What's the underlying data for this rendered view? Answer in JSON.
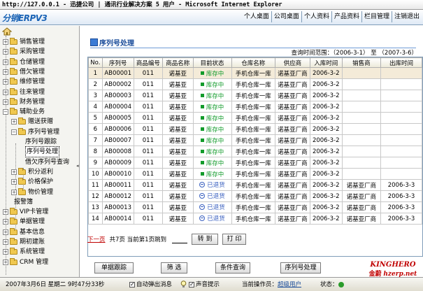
{
  "window": {
    "title": "http://127.0.0.1 - 迅捷公司  | 通讯行业解决方案 5 用户 - Microsoft Internet Explorer"
  },
  "header": {
    "logo_text": "分销ERPV3",
    "nav": [
      "个人桌面",
      "公司桌面",
      "个人资料",
      "产品资料",
      "栏目管理",
      "注销退出"
    ]
  },
  "sidebar": {
    "items": [
      {
        "label": "销售管理",
        "level": 0,
        "expanded": false
      },
      {
        "label": "采购管理",
        "level": 0,
        "expanded": false
      },
      {
        "label": "仓储管理",
        "level": 0,
        "expanded": false
      },
      {
        "label": "借欠管理",
        "level": 0,
        "expanded": false
      },
      {
        "label": "维修管理",
        "level": 0,
        "expanded": false
      },
      {
        "label": "往来管理",
        "level": 0,
        "expanded": false
      },
      {
        "label": "财务管理",
        "level": 0,
        "expanded": false
      },
      {
        "label": "辅助业务",
        "level": 0,
        "expanded": true
      },
      {
        "label": "赠送获赠",
        "level": 1,
        "expanded": false
      },
      {
        "label": "序列号管理",
        "level": 1,
        "expanded": true
      },
      {
        "label": "序列号跟踪",
        "level": 2
      },
      {
        "label": "序列号处理",
        "level": 2,
        "selected": true
      },
      {
        "label": "借欠序列号查询",
        "level": 2
      },
      {
        "label": "积分返利",
        "level": 1,
        "expanded": false
      },
      {
        "label": "价格保护",
        "level": 1,
        "expanded": false
      },
      {
        "label": "物价管理",
        "level": 1,
        "expanded": false
      },
      {
        "label": "报警簿",
        "level": 1
      },
      {
        "label": "VIP卡管理",
        "level": 0,
        "expanded": false
      },
      {
        "label": "单据管理",
        "level": 0,
        "expanded": false
      },
      {
        "label": "基本信息",
        "level": 0,
        "expanded": false
      },
      {
        "label": "期初建账",
        "level": 0,
        "expanded": false
      },
      {
        "label": "系统管理",
        "level": 0,
        "expanded": false
      },
      {
        "label": "CRM 管理",
        "level": 0,
        "expanded": false
      }
    ]
  },
  "main": {
    "heading": "序列号处理",
    "query_range": "查询时间范围：（2006-3-1） 至 （2007-3-6）",
    "table": {
      "columns": [
        "No.",
        "序列号",
        "商品编号",
        "商品名称",
        "目前状态",
        "仓库名称",
        "供应商",
        "入库时间",
        "销售商",
        "出库时间"
      ],
      "rows": [
        [
          "1",
          "AB00001",
          "011",
          "诺基亚",
          "库存中",
          "手机仓库一库",
          "诺基亚厂商",
          "2006-3-2",
          "",
          ""
        ],
        [
          "2",
          "AB00002",
          "011",
          "诺基亚",
          "库存中",
          "手机仓库一库",
          "诺基亚厂商",
          "2006-3-2",
          "",
          ""
        ],
        [
          "3",
          "AB00003",
          "011",
          "诺基亚",
          "库存中",
          "手机仓库一库",
          "诺基亚厂商",
          "2006-3-2",
          "",
          ""
        ],
        [
          "4",
          "AB00004",
          "011",
          "诺基亚",
          "库存中",
          "手机仓库一库",
          "诺基亚厂商",
          "2006-3-2",
          "",
          ""
        ],
        [
          "5",
          "AB00005",
          "011",
          "诺基亚",
          "库存中",
          "手机仓库一库",
          "诺基亚厂商",
          "2006-3-2",
          "",
          ""
        ],
        [
          "6",
          "AB00006",
          "011",
          "诺基亚",
          "库存中",
          "手机仓库一库",
          "诺基亚厂商",
          "2006-3-2",
          "",
          ""
        ],
        [
          "7",
          "AB00007",
          "011",
          "诺基亚",
          "库存中",
          "手机仓库一库",
          "诺基亚厂商",
          "2006-3-2",
          "",
          ""
        ],
        [
          "8",
          "AB00008",
          "011",
          "诺基亚",
          "库存中",
          "手机仓库一库",
          "诺基亚厂商",
          "2006-3-2",
          "",
          ""
        ],
        [
          "9",
          "AB00009",
          "011",
          "诺基亚",
          "库存中",
          "手机仓库一库",
          "诺基亚厂商",
          "2006-3-2",
          "",
          ""
        ],
        [
          "10",
          "AB00010",
          "011",
          "诺基亚",
          "库存中",
          "手机仓库一库",
          "诺基亚厂商",
          "2006-3-2",
          "",
          ""
        ],
        [
          "11",
          "AB00011",
          "011",
          "诺基亚",
          "已退货",
          "手机仓库一库",
          "诺基亚厂商",
          "2006-3-2",
          "诺基亚厂商",
          "2006-3-3"
        ],
        [
          "12",
          "AB00012",
          "011",
          "诺基亚",
          "已退货",
          "手机仓库一库",
          "诺基亚厂商",
          "2006-3-2",
          "诺基亚厂商",
          "2006-3-3"
        ],
        [
          "13",
          "AB00013",
          "011",
          "诺基亚",
          "已退货",
          "手机仓库一库",
          "诺基亚厂商",
          "2006-3-2",
          "诺基亚厂商",
          "2006-3-3"
        ],
        [
          "14",
          "AB00014",
          "011",
          "诺基亚",
          "已退货",
          "手机仓库一库",
          "诺基亚厂商",
          "2006-3-2",
          "诺基亚厂商",
          "2006-3-3"
        ]
      ],
      "selected_row": 0
    },
    "pager": {
      "next_label": "下一页",
      "pages_text": "共7页  当前第1页跳到",
      "goto_label": "转 到",
      "print_label": "打 印"
    },
    "actions": [
      "单据跟踪",
      "筛 选",
      "条件查询",
      "序列号处理"
    ]
  },
  "footer": {
    "datetime": "2007年3月6日 星期二  9时47分33秒",
    "popup_label": "自动弹出消息",
    "sound_label": "声音提示",
    "operator_label": "当前操作员：",
    "operator_name": "超级用户",
    "status_label": "状态："
  },
  "brand": {
    "main": "KINGHERO",
    "cn": "金蔚",
    "url": "hzerp.net"
  },
  "colors": {
    "accent": "#1a4c9a",
    "in_stock": "#129b2b",
    "returned": "#3a60c0",
    "selected_row": "#f4ebd8",
    "brand": "#c00000"
  }
}
